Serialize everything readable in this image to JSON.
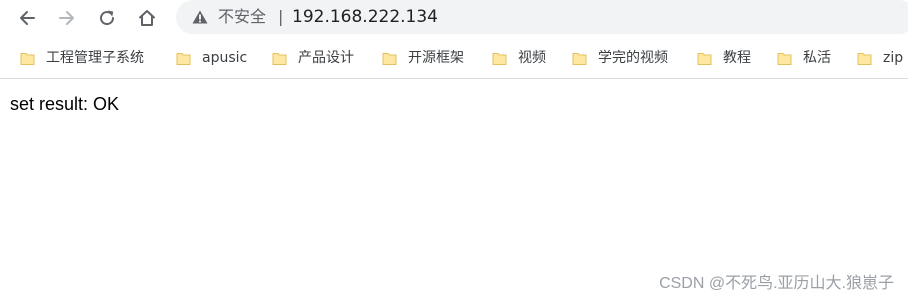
{
  "omnibox": {
    "security_label": "不安全",
    "separator": "|",
    "url": "192.168.222.134"
  },
  "bookmarks": [
    {
      "label": "工程管理子系统"
    },
    {
      "label": "apusic"
    },
    {
      "label": "产品设计"
    },
    {
      "label": "开源框架"
    },
    {
      "label": "视频"
    },
    {
      "label": "学完的视频"
    },
    {
      "label": "教程"
    },
    {
      "label": "私活"
    },
    {
      "label": "zip"
    }
  ],
  "page": {
    "body_text": "set result: OK"
  },
  "watermark": {
    "text": "CSDN @不死鸟.亚历山大.狼崽子"
  },
  "colors": {
    "folder_fill": "#fde7a1",
    "folder_stroke": "#e4c060",
    "toolbar_icon": "#5f6368"
  }
}
